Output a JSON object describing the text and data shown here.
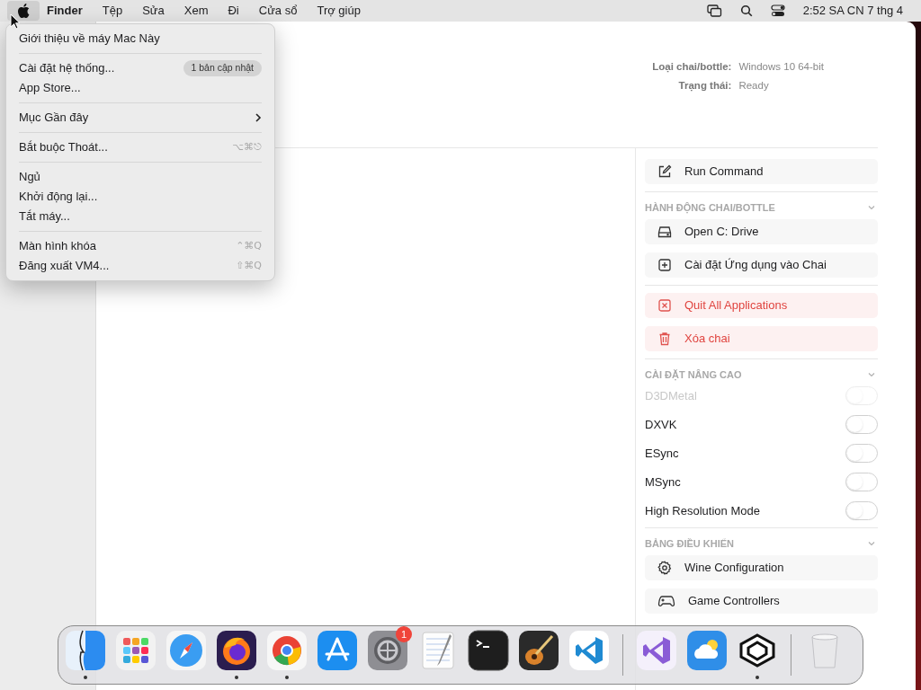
{
  "menubar": {
    "apple": {
      "selected": true
    },
    "menus": [
      {
        "label": "Finder",
        "kind": "app"
      },
      {
        "label": "Tệp",
        "kind": "menu"
      },
      {
        "label": "Sửa",
        "kind": "menu"
      },
      {
        "label": "Xem",
        "kind": "menu"
      },
      {
        "label": "Đi",
        "kind": "menu"
      },
      {
        "label": "Cửa sổ",
        "kind": "menu"
      },
      {
        "label": "Trợ giúp",
        "kind": "menu"
      }
    ],
    "clock": "2:52 SA CN 7 thg 4"
  },
  "apple_menu": {
    "groups": [
      [
        {
          "label": "Giới thiệu về máy Mac Này",
          "kind": "command"
        }
      ],
      [
        {
          "label": "Cài đặt hệ thống...",
          "kind": "command",
          "badge": "1 bản cập nhật"
        },
        {
          "label": "App Store...",
          "kind": "command"
        }
      ],
      [
        {
          "label": "Mục Gần đây",
          "kind": "submenu"
        }
      ],
      [
        {
          "label": "Bắt buộc Thoát...",
          "kind": "command",
          "shortcut": "⌥⌘⎋"
        }
      ],
      [
        {
          "label": "Ngủ",
          "kind": "command"
        },
        {
          "label": "Khởi động lại...",
          "kind": "command"
        },
        {
          "label": "Tắt máy...",
          "kind": "command"
        }
      ],
      [
        {
          "label": "Màn hình khóa",
          "kind": "command",
          "shortcut": "⌃⌘Q"
        },
        {
          "label": "Đăng xuất VM4...",
          "kind": "command",
          "shortcut": "⇧⌘Q"
        }
      ]
    ]
  },
  "window": {
    "info": [
      {
        "label": "Loại chai/bottle:",
        "value": "Windows 10 64-bit"
      },
      {
        "label": "Trạng thái:",
        "value": "Ready"
      }
    ],
    "sections": [
      {
        "items": [
          {
            "kind": "action",
            "label": "Run Command"
          }
        ]
      },
      {
        "title": "HÀNH ĐỘNG CHAI/BOTTLE",
        "expanded": true,
        "items": [
          {
            "kind": "action",
            "label": "Open C: Drive"
          },
          {
            "kind": "action",
            "label": "Cài đặt Ứng dụng vào Chai"
          }
        ]
      },
      {
        "items": [
          {
            "kind": "destructive",
            "label": "Quit All Applications"
          },
          {
            "kind": "destructive",
            "label": "Xóa chai"
          }
        ]
      },
      {
        "title": "CÀI ĐẶT NÂNG CAO",
        "expanded": true,
        "items": [
          {
            "kind": "toggle",
            "label": "D3DMetal",
            "on": false,
            "disabled": true
          },
          {
            "kind": "toggle",
            "label": "DXVK",
            "on": false,
            "disabled": false
          },
          {
            "kind": "toggle",
            "label": "ESync",
            "on": false,
            "disabled": false
          },
          {
            "kind": "toggle",
            "label": "MSync",
            "on": false,
            "disabled": false
          },
          {
            "kind": "toggle",
            "label": "High Resolution Mode",
            "on": false,
            "disabled": false
          }
        ]
      },
      {
        "title": "BẢNG ĐIỀU KHIỂN",
        "expanded": true,
        "items": [
          {
            "kind": "action",
            "label": "Wine Configuration"
          },
          {
            "kind": "action",
            "label": "Game Controllers"
          }
        ]
      }
    ]
  },
  "dock": {
    "items": [
      {
        "kind": "app",
        "running": true
      },
      {
        "kind": "app",
        "running": false
      },
      {
        "kind": "app",
        "running": false
      },
      {
        "kind": "app",
        "running": true
      },
      {
        "kind": "app",
        "running": true
      },
      {
        "kind": "app",
        "running": false
      },
      {
        "kind": "app",
        "running": false,
        "badge": "1"
      },
      {
        "kind": "app",
        "running": false
      },
      {
        "kind": "app",
        "running": false
      },
      {
        "kind": "app",
        "running": false
      },
      {
        "kind": "app",
        "running": false
      },
      {
        "kind": "separator"
      },
      {
        "kind": "app",
        "running": false
      },
      {
        "kind": "app",
        "running": false
      },
      {
        "kind": "app",
        "running": true
      },
      {
        "kind": "separator"
      },
      {
        "kind": "trash",
        "running": false
      }
    ]
  }
}
